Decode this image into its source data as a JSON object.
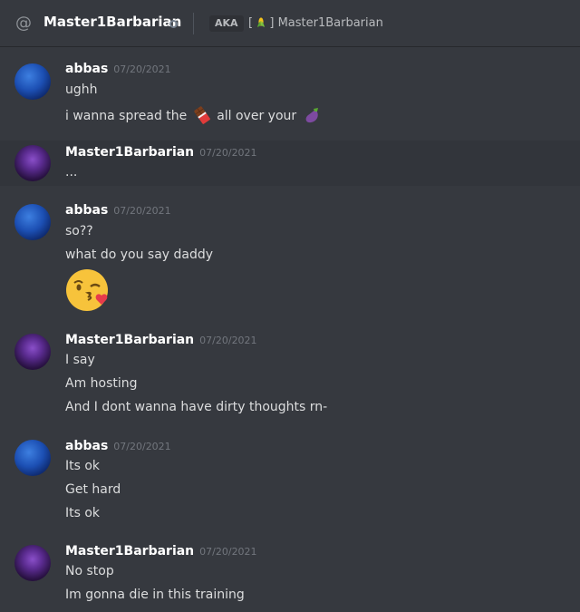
{
  "header": {
    "channel_name": "Master1Barbarian",
    "aka_label": "AKA",
    "nickname_prefix": "[",
    "nickname_suffix": "] Master1Barbarian"
  },
  "messages": [
    {
      "author": "abbas",
      "timestamp": "07/20/2021",
      "lines": [
        "ughh",
        "i wanna spread the",
        "all over your"
      ]
    },
    {
      "author": "Master1Barbarian",
      "timestamp": "07/20/2021",
      "lines": [
        "..."
      ]
    },
    {
      "author": "abbas",
      "timestamp": "07/20/2021",
      "lines": [
        "so??",
        "what do you say daddy"
      ]
    },
    {
      "author": "Master1Barbarian",
      "timestamp": "07/20/2021",
      "lines": [
        "I say",
        "Am hosting",
        "And I dont wanna have dirty thoughts rn-"
      ]
    },
    {
      "author": "abbas",
      "timestamp": "07/20/2021",
      "lines": [
        "Its ok",
        "Get hard",
        "Its ok"
      ]
    },
    {
      "author": "Master1Barbarian",
      "timestamp": "07/20/2021",
      "lines": [
        "No stop",
        "Im gonna die in this training"
      ]
    }
  ],
  "icons": {
    "at": "at-icon",
    "status": "offline-status-icon",
    "corn": "corn-emoji",
    "chocolate": "chocolate-bar-emoji",
    "eggplant": "eggplant-emoji",
    "kiss": "face-blowing-kiss-emoji"
  }
}
